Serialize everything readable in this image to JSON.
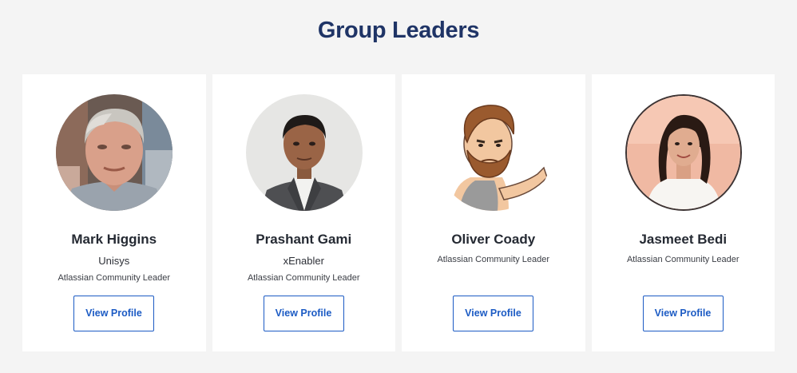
{
  "section": {
    "title": "Group Leaders"
  },
  "leaders": [
    {
      "name": "Mark Higgins",
      "company": "Unisys",
      "role": "Atlassian Community Leader",
      "button_label": "View Profile",
      "avatar_icon": "photo-man-grey-hair"
    },
    {
      "name": "Prashant Gami",
      "company": "xEnabler",
      "role": "Atlassian Community Leader",
      "button_label": "View Profile",
      "avatar_icon": "photo-man-suit"
    },
    {
      "name": "Oliver Coady",
      "role": "Atlassian Community Leader",
      "button_label": "View Profile",
      "avatar_icon": "cartoon-bearded-man"
    },
    {
      "name": "Jasmeet Bedi",
      "role": "Atlassian Community Leader",
      "button_label": "View Profile",
      "avatar_icon": "photo-woman-peach-background"
    }
  ],
  "colors": {
    "page_background": "#f4f4f4",
    "card_background": "#ffffff",
    "title": "#1f3466",
    "button_accent": "#1c5bc4"
  }
}
